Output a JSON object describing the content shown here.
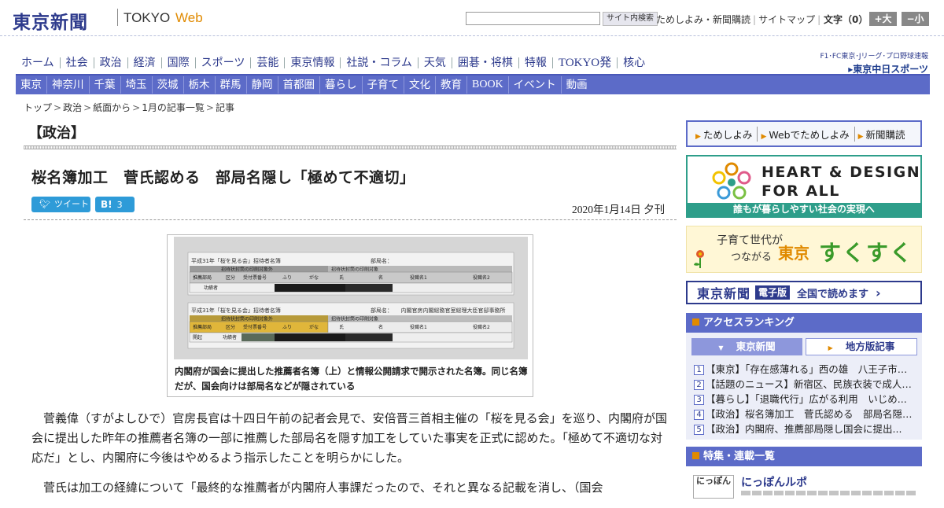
{
  "header": {
    "logo": "東京新聞",
    "logo_tokyo": "TOKYO",
    "logo_web": "Web",
    "search_button": "サイト内検索",
    "util_links": [
      "ためしよみ・新聞購読",
      "サイトマップ"
    ],
    "font_size_label": "文字（0）",
    "font_up": "+大",
    "font_down": "−小"
  },
  "nav_main": [
    "ホーム",
    "社会",
    "政治",
    "経済",
    "国際",
    "スポーツ",
    "芸能",
    "東京情報",
    "社説・コラム",
    "天気",
    "囲碁・将棋",
    "特報",
    "TOKYO発",
    "核心"
  ],
  "chunichi": {
    "top": "F1･FC東京･Jリーグ･プロ野球速報",
    "logo": "▸東京中日スポーツ"
  },
  "nav_region": [
    "東京",
    "神奈川",
    "千葉",
    "埼玉",
    "茨城",
    "栃木",
    "群馬",
    "静岡",
    "首都圏",
    "暮らし",
    "子育て",
    "文化",
    "教育",
    "BOOK",
    "イベント",
    "動画"
  ],
  "breadcrumb": [
    "トップ",
    "政治",
    "紙面から",
    "1月の記事一覧",
    "記事"
  ],
  "article": {
    "section": "【政治】",
    "headline": "桜名簿加工　菅氏認める　部局名隠し「極めて不適切」",
    "tweet_label": "ツイート",
    "hatena_label": "B!",
    "hatena_count": "3",
    "date": "2020年1月14日 夕刊",
    "caption": "内閣府が国会に提出した推薦者名簿（上）と情報公開請求で開示された名簿。同じ名簿だが、国会向けは部局名などが隠されている",
    "paragraphs": [
      "菅義偉（すがよしひで）官房長官は十四日午前の記者会見で、安倍晋三首相主催の「桜を見る会」を巡り、内閣府が国会に提出した昨年の推薦者名簿の一部に推薦した部局名を隠す加工をしていた事実を正式に認めた。「極めて不適切な対応だ」とし、内閣府に今後はやめるよう指示したことを明らかにした。",
      "菅氏は加工の経緯について「最終的な推薦者が内閣府人事課だったので、それと異なる記載を消し、（国会"
    ]
  },
  "photo": {
    "doc1_title": "平成31年「桜を見る会」招待者名簿",
    "doc1_bureau": "部局名：",
    "doc2_title": "平成31年「桜を見る会」招待者名簿",
    "doc2_bureau": "部局名：　　内閣官房内閣総務官室総理大臣官邸事務所",
    "band_left": "招待状封筒の印刷対象外",
    "band_right": "招待状封筒の印刷対象",
    "cols_left": [
      "推薦部局",
      "区分",
      "受付票番号",
      "ふり",
      "がな"
    ],
    "cols_right": [
      "氏",
      "名",
      "役職名1",
      "役職名2"
    ],
    "row1": "功績者",
    "row2a": "開起",
    "row2b": "功績者"
  },
  "sidebar": {
    "links": [
      "ためしよみ",
      "Webでためしよみ",
      "新聞購読"
    ],
    "heart_line1": "HEART & DESIGN",
    "heart_line2": "FOR ALL",
    "heart_bar": "誰もが暮らしやすい社会の実現へ",
    "suku_line1": "子育て世代が",
    "suku_line2": "つながる",
    "suku_tokyo": "東京",
    "suku_big": "すくすく",
    "eban_logo": "東京新聞",
    "eban_tag": "電子版",
    "eban_text": "全国で読めます",
    "ranking_title": "アクセスランキング",
    "ranking_tabs": [
      "東京新聞",
      "地方版記事"
    ],
    "ranking": [
      {
        "num": "1",
        "text": "【東京】「存在感薄れる」西の雄　八王子市、多摩地域の..."
      },
      {
        "num": "2",
        "text": "【話題のニュース】新宿区、民族衣装で成人式..."
      },
      {
        "num": "3",
        "text": "【暮らし】「退職代行」広がる利用　いじめ..."
      },
      {
        "num": "4",
        "text": "【政治】桜名簿加工　菅氏認める　部局名隠し..."
      },
      {
        "num": "5",
        "text": "【政治】内閣府、推薦部局隠し国会に提出..."
      }
    ],
    "feature_title": "特集・連載一覧",
    "feature_thumb": "にっぽん",
    "feature_item": "にっぽんルポ"
  },
  "colors": {
    "brand": "#2d3a8c",
    "nav": "#5c6bc8",
    "accent": "#e08a00",
    "teal": "#2e9e8a"
  }
}
